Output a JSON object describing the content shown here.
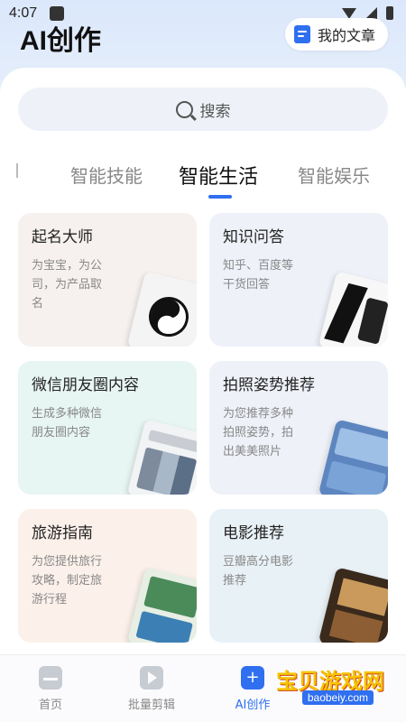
{
  "status_bar": {
    "time": "4:07"
  },
  "header": {
    "title": "AI创作",
    "my_articles": "我的文章"
  },
  "search": {
    "placeholder": "搜索"
  },
  "tabs": [
    {
      "label": "智能技能",
      "active": false
    },
    {
      "label": "智能生活",
      "active": true
    },
    {
      "label": "智能娱乐",
      "active": false
    }
  ],
  "cards": [
    {
      "title": "起名大师",
      "desc": "为宝宝，为公司，为产品取名"
    },
    {
      "title": "知识问答",
      "desc": "知乎、百度等干货回答"
    },
    {
      "title": "微信朋友圈内容",
      "desc": "生成多种微信朋友圈内容"
    },
    {
      "title": "拍照姿势推荐",
      "desc": "为您推荐多种拍照姿势，拍出美美照片"
    },
    {
      "title": "旅游指南",
      "desc": "为您提供旅行攻略，制定旅游行程"
    },
    {
      "title": "电影推荐",
      "desc": "豆瓣高分电影推荐"
    }
  ],
  "bottom_nav": [
    {
      "label": "首页",
      "active": false
    },
    {
      "label": "批量剪辑",
      "active": false
    },
    {
      "label": "AI创作",
      "active": true
    }
  ],
  "watermark": {
    "text": "宝贝游戏网",
    "url": "baobeiy.com"
  },
  "colors": {
    "accent": "#2f6ff0"
  }
}
